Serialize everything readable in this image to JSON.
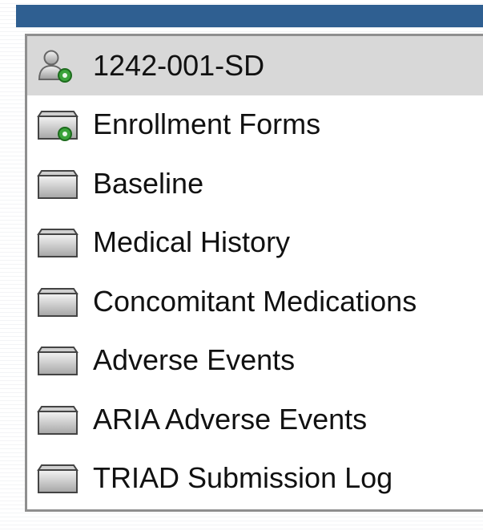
{
  "tree": {
    "items": [
      {
        "label": "1242-001-SD",
        "icon": "subject-user-icon",
        "selected": true,
        "status_dot": true
      },
      {
        "label": "Enrollment Forms",
        "icon": "folder-icon",
        "selected": false,
        "status_dot": true
      },
      {
        "label": "Baseline",
        "icon": "folder-icon",
        "selected": false,
        "status_dot": false
      },
      {
        "label": "Medical History",
        "icon": "folder-icon",
        "selected": false,
        "status_dot": false
      },
      {
        "label": "Concomitant Medications",
        "icon": "folder-icon",
        "selected": false,
        "status_dot": false
      },
      {
        "label": "Adverse Events",
        "icon": "folder-icon",
        "selected": false,
        "status_dot": false
      },
      {
        "label": "ARIA Adverse Events",
        "icon": "folder-icon",
        "selected": false,
        "status_dot": false
      },
      {
        "label": "TRIAD Submission Log",
        "icon": "folder-icon",
        "selected": false,
        "status_dot": false
      }
    ]
  },
  "colors": {
    "top_bar": "#2f5f91",
    "panel_border": "#8f8f8f",
    "selected_bg": "#d8d8d8",
    "status_dot": "#3aa33a"
  }
}
